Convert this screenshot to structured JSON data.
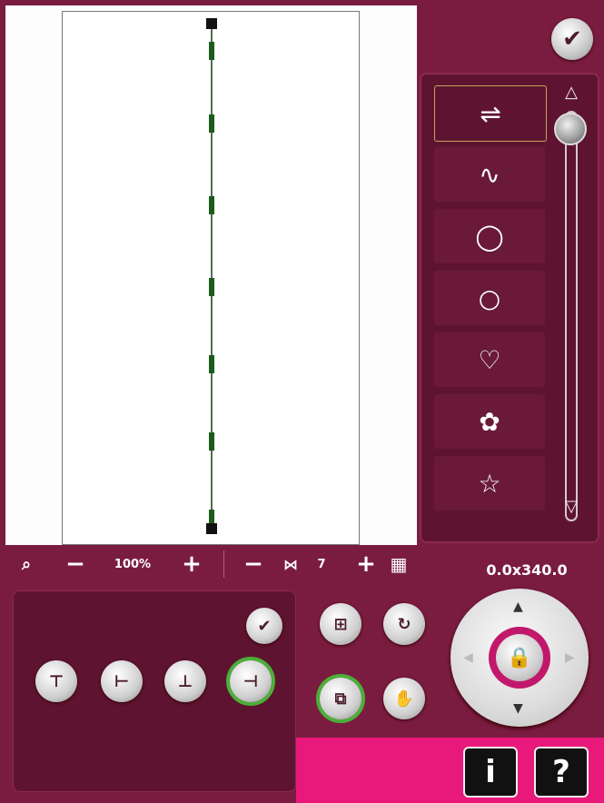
{
  "toolbar": {
    "zoom_minus": "−",
    "zoom_value": "100%",
    "zoom_plus": "+",
    "density_minus": "−",
    "density_value": "7",
    "density_plus": "+"
  },
  "coordinates": "0.0x340.0",
  "confirm_symbol": "✔",
  "shapes": [
    {
      "name": "straight-line",
      "glyph": "⇌"
    },
    {
      "name": "wave",
      "glyph": "∿"
    },
    {
      "name": "circle-large",
      "glyph": "◯"
    },
    {
      "name": "circle-small",
      "glyph": "○"
    },
    {
      "name": "heart",
      "glyph": "♡"
    },
    {
      "name": "flower",
      "glyph": "✿"
    },
    {
      "name": "star",
      "glyph": "☆"
    }
  ],
  "info_label": "i",
  "help_label": "?",
  "colors": {
    "background": "#7a1c40",
    "panel": "#5e1430",
    "accent_pink": "#e8197b",
    "active_green": "#4caf3a",
    "stitch_green": "#1a5c1a"
  }
}
